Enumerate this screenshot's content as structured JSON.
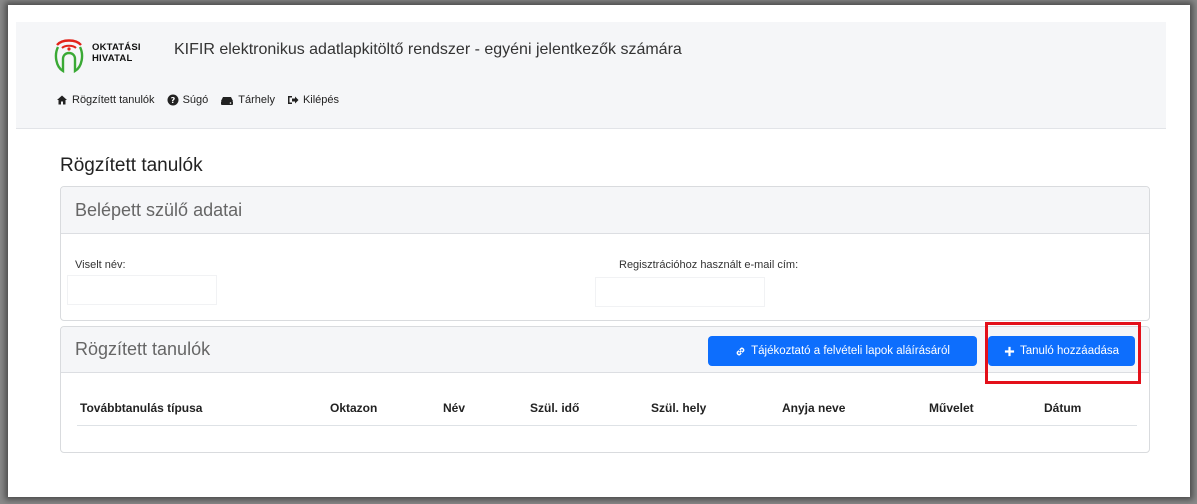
{
  "header": {
    "logo_line1": "OKTATÁSI",
    "logo_line2": "HIVATAL",
    "title": "KIFIR elektronikus adatlapkitöltő rendszer - egyéni jelentkezők számára"
  },
  "nav": [
    {
      "label": "Rögzített tanulók",
      "icon": "home-icon"
    },
    {
      "label": "Súgó",
      "icon": "question-circle-icon"
    },
    {
      "label": "Tárhely",
      "icon": "hdd-icon"
    },
    {
      "label": "Kilépés",
      "icon": "sign-out-icon"
    }
  ],
  "page_title": "Rögzített tanulók",
  "parent_card": {
    "title": "Belépett szülő adatai",
    "name_label": "Viselt név:",
    "name_value": "",
    "email_label": "Regisztrációhoz használt e-mail cím:",
    "email_value": ""
  },
  "students_card": {
    "title": "Rögzített tanulók",
    "info_button": "Tájékoztató a felvételi lapok aláírásáról",
    "add_button": "Tanuló hozzáadása",
    "columns": [
      "Továbbtanulás típusa",
      "Oktazon",
      "Név",
      "Szül. idő",
      "Szül. hely",
      "Anyja neve",
      "Művelet",
      "Dátum"
    ]
  },
  "colors": {
    "primary": "#0d6efd",
    "highlight": "#e3101a",
    "logo_green": "#3aa935",
    "logo_red": "#e2231a"
  }
}
